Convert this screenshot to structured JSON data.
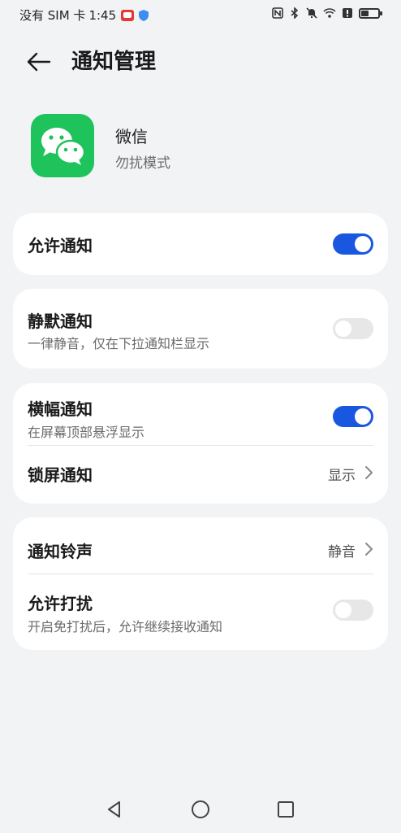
{
  "status_bar": {
    "carrier": "没有 SIM 卡",
    "time": "1:45",
    "icons": [
      "nfc-icon",
      "bluetooth-icon",
      "mute-bell-icon",
      "wifi-icon",
      "alert-icon",
      "battery-icon"
    ]
  },
  "header": {
    "back_icon": "arrow-left-icon",
    "title": "通知管理"
  },
  "app": {
    "name": "微信",
    "mode": "勿扰模式",
    "icon": "wechat-icon",
    "icon_color": "#1fc35b"
  },
  "settings": {
    "allow_notifications": {
      "label": "允许通知",
      "enabled": true
    },
    "silent_notifications": {
      "label": "静默通知",
      "description": "一律静音，仅在下拉通知栏显示",
      "enabled": false
    },
    "banner_notifications": {
      "label": "横幅通知",
      "description": "在屏幕顶部悬浮显示",
      "enabled": true
    },
    "lockscreen_notifications": {
      "label": "锁屏通知",
      "value": "显示"
    },
    "notification_sound": {
      "label": "通知铃声",
      "value": "静音"
    },
    "allow_interruptions": {
      "label": "允许打扰",
      "description": "开启免打扰后，允许继续接收通知",
      "enabled": false
    }
  },
  "navbar": {
    "icons": [
      "back-triangle-icon",
      "home-circle-icon",
      "recents-square-icon"
    ]
  },
  "colors": {
    "accent": "#1a57e0",
    "background": "#f1f3f5",
    "card": "#ffffff",
    "toggle_off": "#e7e7e7"
  }
}
